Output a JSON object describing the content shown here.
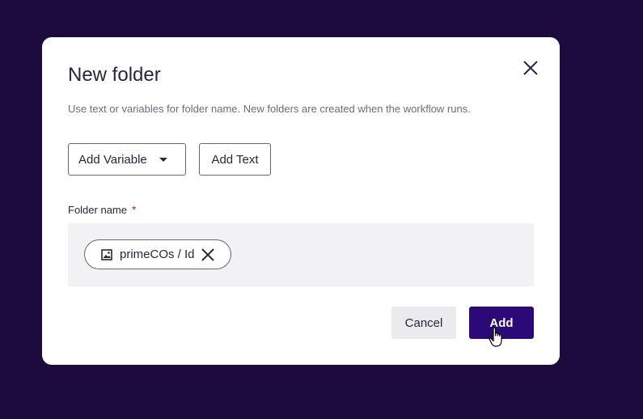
{
  "dialog": {
    "title": "New folder",
    "description": "Use text or variables for folder name. New folders are created when the workflow runs.",
    "close_icon": "close-icon"
  },
  "toolbar": {
    "add_variable_label": "Add Variable",
    "add_variable_icon": "caret-down-icon",
    "add_text_label": "Add Text"
  },
  "field": {
    "label": "Folder name",
    "required_marker": "*",
    "chips": [
      {
        "label": "primeCOs / Id",
        "icon": "image-icon",
        "remove_icon": "close-icon"
      }
    ]
  },
  "actions": {
    "cancel_label": "Cancel",
    "add_label": "Add"
  },
  "colors": {
    "backdrop": "#1e0b3d",
    "primary": "#2b0a78",
    "required": "#c2185b",
    "field_bg": "#f2f2f4"
  }
}
